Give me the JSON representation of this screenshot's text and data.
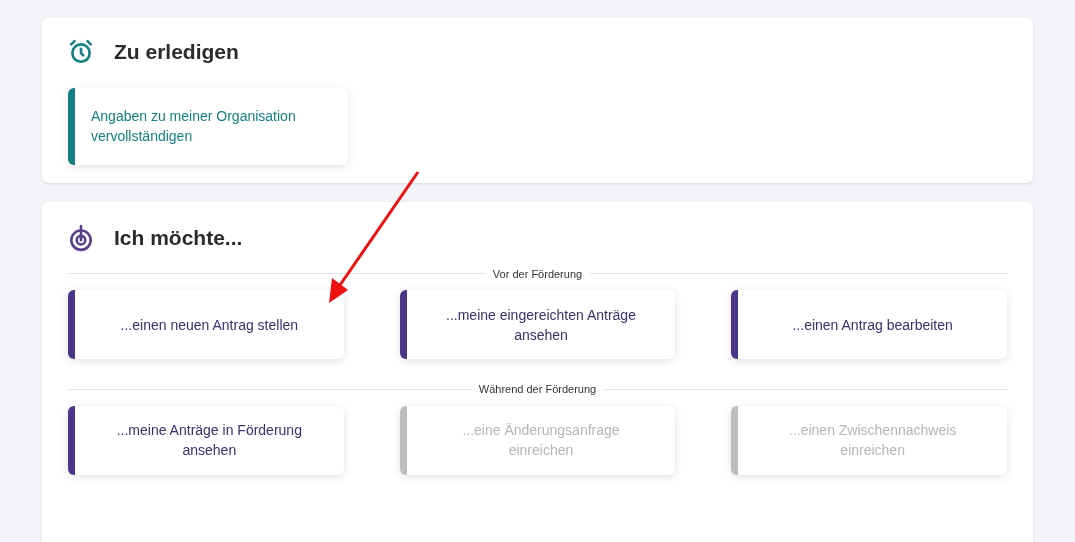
{
  "todo": {
    "title": "Zu erledigen",
    "items": [
      {
        "label": "Angaben zu meiner Organisation vervollständigen"
      }
    ]
  },
  "actions": {
    "title": "Ich möchte...",
    "groups": [
      {
        "label": "Vor der Förderung",
        "items": [
          {
            "label": "...einen neuen Antrag stellen",
            "disabled": false
          },
          {
            "label": "...meine eingereichten Anträge ansehen",
            "disabled": false
          },
          {
            "label": "...einen Antrag bearbeiten",
            "disabled": false
          }
        ]
      },
      {
        "label": "Während der Förderung",
        "items": [
          {
            "label": "...meine Anträge in Förderung ansehen",
            "disabled": false
          },
          {
            "label": "...eine Änderungsanfrage einreichen",
            "disabled": true
          },
          {
            "label": "...einen Zwischennachweis einreichen",
            "disabled": true
          }
        ]
      }
    ]
  }
}
